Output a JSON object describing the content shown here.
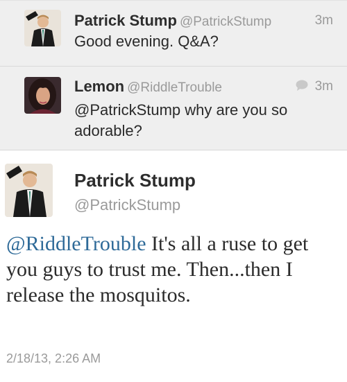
{
  "thread": [
    {
      "name": "Patrick Stump",
      "handle": "@PatrickStump",
      "time": "3m",
      "text": "Good evening. Q&A?",
      "avatar_icon": "patrick-avatar"
    },
    {
      "name": "Lemon",
      "handle": "@RiddleTrouble",
      "time": "3m",
      "text": "@PatrickStump why are you so adorable?",
      "avatar_icon": "lemon-avatar",
      "reply_icon": "speech-bubble-icon"
    }
  ],
  "main_tweet": {
    "name": "Patrick Stump",
    "handle": "@PatrickStump",
    "mention": "@RiddleTrouble",
    "text": " It's all a ruse to get you guys to trust me. Then...then I release the mosquitos.",
    "timestamp": "2/18/13, 2:26 AM",
    "avatar_icon": "patrick-avatar"
  },
  "colors": {
    "background_thread": "#efefef",
    "mention": "#2e6a98",
    "muted": "#9a9a9a"
  }
}
